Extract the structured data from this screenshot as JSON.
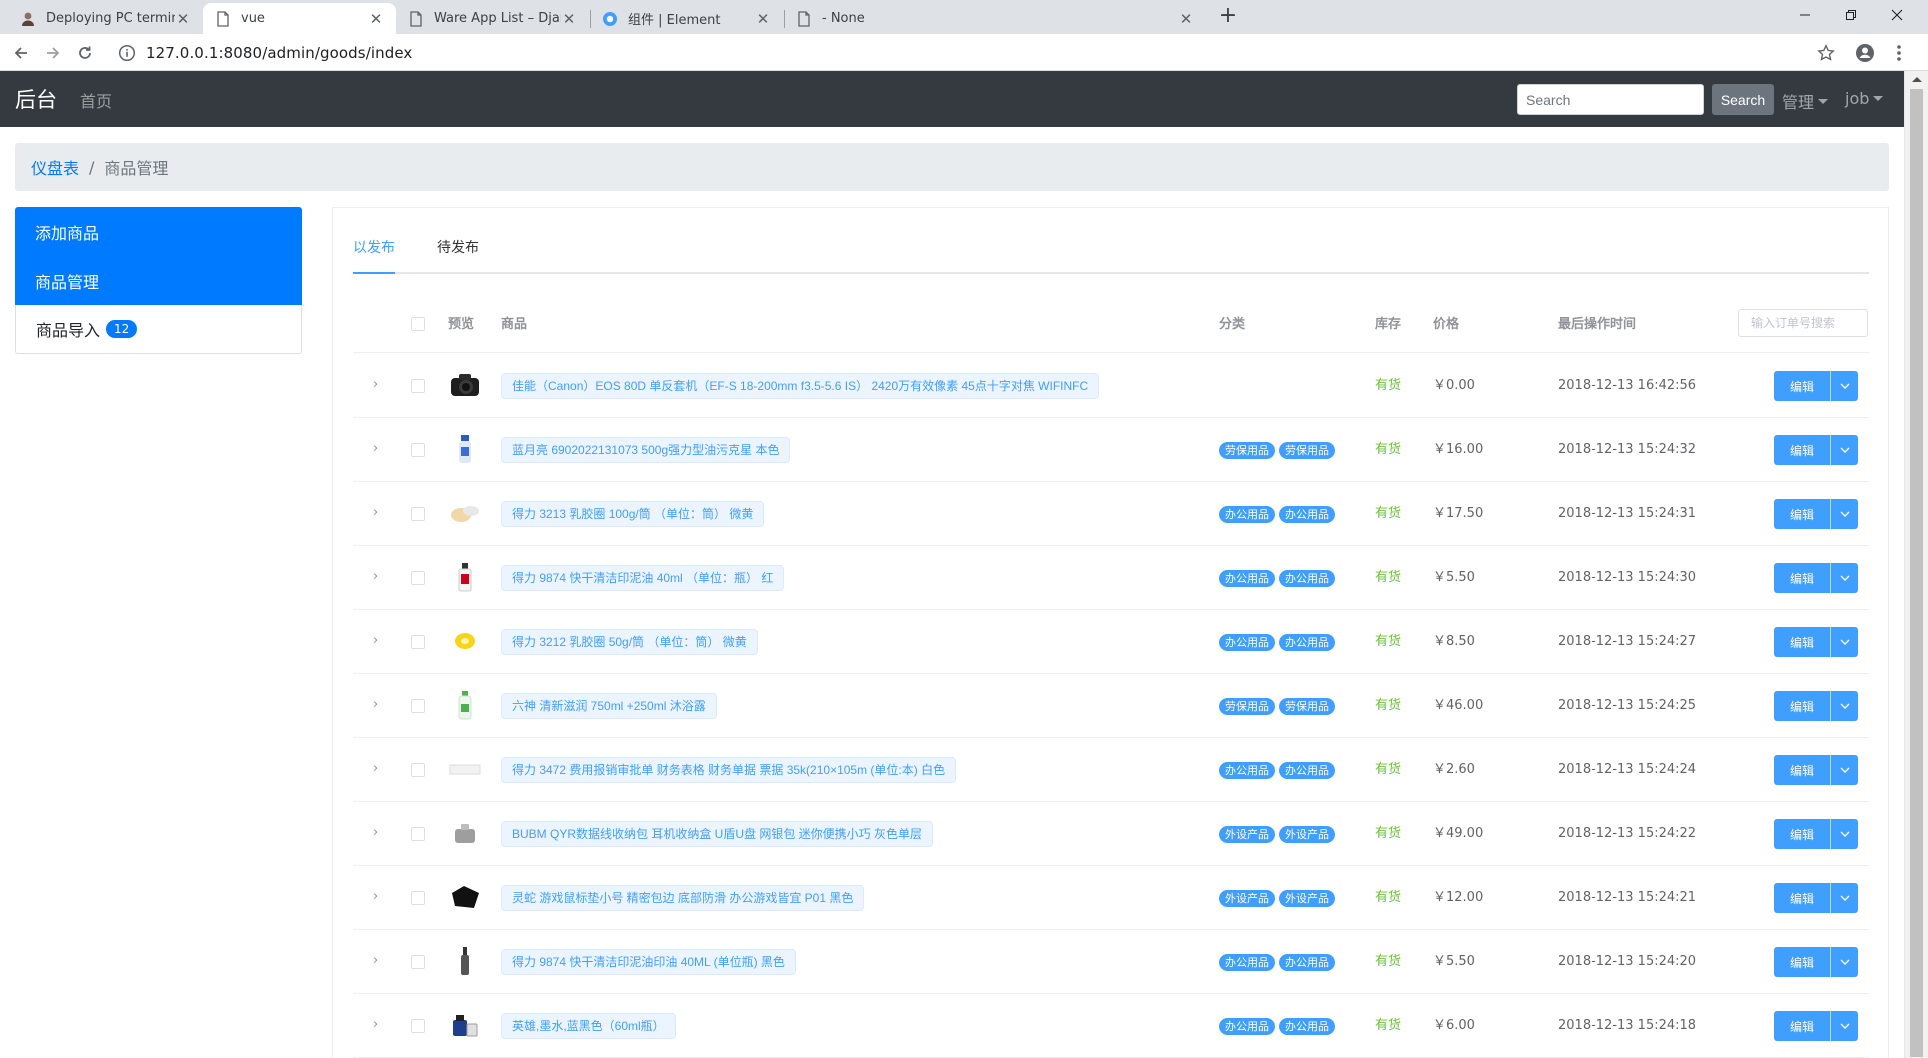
{
  "browser": {
    "tabs": [
      {
        "title": "Deploying PC terminal test en",
        "icon": "avatar-icon",
        "active": false
      },
      {
        "title": "vue",
        "icon": "page-icon",
        "active": true
      },
      {
        "title": "Ware App List – Django REST",
        "icon": "page-icon",
        "active": false
      },
      {
        "title": "组件 | Element",
        "icon": "element-logo-icon",
        "active": false
      },
      {
        "title": "- None",
        "icon": "page-icon",
        "active": false
      }
    ],
    "url": "127.0.0.1:8080/admin/goods/index",
    "close_glyph": "✕",
    "new_tab_glyph": "+"
  },
  "navbar": {
    "brand": "后台",
    "home": "首页",
    "search_placeholder": "Search",
    "search_button": "Search",
    "manage": "管理",
    "user": "job"
  },
  "breadcrumb": {
    "root": "仪盘表",
    "separator": "/",
    "current": "商品管理"
  },
  "sidebar": {
    "items": [
      {
        "label": "添加商品",
        "active": true
      },
      {
        "label": "商品管理",
        "active": true
      },
      {
        "label": "商品导入",
        "badge": "12",
        "active": false
      }
    ]
  },
  "tabs": {
    "published": "以发布",
    "pending": "待发布"
  },
  "table": {
    "headers": {
      "preview": "预览",
      "product": "商品",
      "category": "分类",
      "stock": "库存",
      "price": "价格",
      "time": "最后操作时间"
    },
    "search_placeholder": "输入订单号搜索",
    "edit_label": "编辑",
    "expand_glyph": "›",
    "rows": [
      {
        "product": "佳能（Canon）EOS 80D 单反套机（EF-S 18-200mm f3.5-5.6 IS） 2420万有效像素 45点十字对焦 WIFINFC",
        "cats": [],
        "stock": "有货",
        "price": "￥0.00",
        "time": "2018-12-13 16:42:56",
        "thumb": "camera"
      },
      {
        "product": "蓝月亮 6902022131073 500g强力型油污克星 本色",
        "cats": [
          "劳保用品",
          "劳保用品"
        ],
        "stock": "有货",
        "price": "￥16.00",
        "time": "2018-12-13 15:24:32",
        "thumb": "spray"
      },
      {
        "product": "得力 3213 乳胶圈 100g/筒 （单位：筒） 微黄",
        "cats": [
          "办公用品",
          "办公用品"
        ],
        "stock": "有货",
        "price": "￥17.50",
        "time": "2018-12-13 15:24:31",
        "thumb": "bands"
      },
      {
        "product": "得力 9874 快干清洁印泥油 40ml （单位：瓶） 红",
        "cats": [
          "办公用品",
          "办公用品"
        ],
        "stock": "有货",
        "price": "￥5.50",
        "time": "2018-12-13 15:24:30",
        "thumb": "redbottle"
      },
      {
        "product": "得力 3212 乳胶圈 50g/筒 （单位：筒） 微黄",
        "cats": [
          "办公用品",
          "办公用品"
        ],
        "stock": "有货",
        "price": "￥8.50",
        "time": "2018-12-13 15:24:27",
        "thumb": "yellow"
      },
      {
        "product": "六神 清新滋润 750ml +250ml 沐浴露",
        "cats": [
          "劳保用品",
          "劳保用品"
        ],
        "stock": "有货",
        "price": "￥46.00",
        "time": "2018-12-13 15:24:25",
        "thumb": "greenbottle"
      },
      {
        "product": "得力 3472 费用报销审批单 财务表格 财务单据 票据 35k(210×105m (单位:本) 白色",
        "cats": [
          "办公用品",
          "办公用品"
        ],
        "stock": "有货",
        "price": "￥2.60",
        "time": "2018-12-13 15:24:24",
        "thumb": "paper"
      },
      {
        "product": "BUBM QYR数据线收纳包 耳机收纳盒 U盾U盘 网银包 迷你便携小巧 灰色单层",
        "cats": [
          "外设产品",
          "外设产品"
        ],
        "stock": "有货",
        "price": "￥49.00",
        "time": "2018-12-13 15:24:22",
        "thumb": "case"
      },
      {
        "product": "灵蛇 游戏鼠标垫小号 精密包边 底部防滑 办公游戏皆宜 P01 黑色",
        "cats": [
          "外设产品",
          "外设产品"
        ],
        "stock": "有货",
        "price": "￥12.00",
        "time": "2018-12-13 15:24:21",
        "thumb": "mousepad"
      },
      {
        "product": "得力 9874 快干清洁印泥油印油 40ML (单位瓶) 黑色",
        "cats": [
          "办公用品",
          "办公用品"
        ],
        "stock": "有货",
        "price": "￥5.50",
        "time": "2018-12-13 15:24:20",
        "thumb": "blackbottle"
      },
      {
        "product": "英雄,墨水,蓝黑色（60ml瓶）",
        "cats": [
          "办公用品",
          "办公用品"
        ],
        "stock": "有货",
        "price": "￥6.00",
        "time": "2018-12-13 15:24:18",
        "thumb": "ink"
      }
    ]
  },
  "colors": {
    "navbar": "#343a40",
    "primary": "#007bff",
    "element_primary": "#409eff",
    "success": "#67c23a"
  }
}
